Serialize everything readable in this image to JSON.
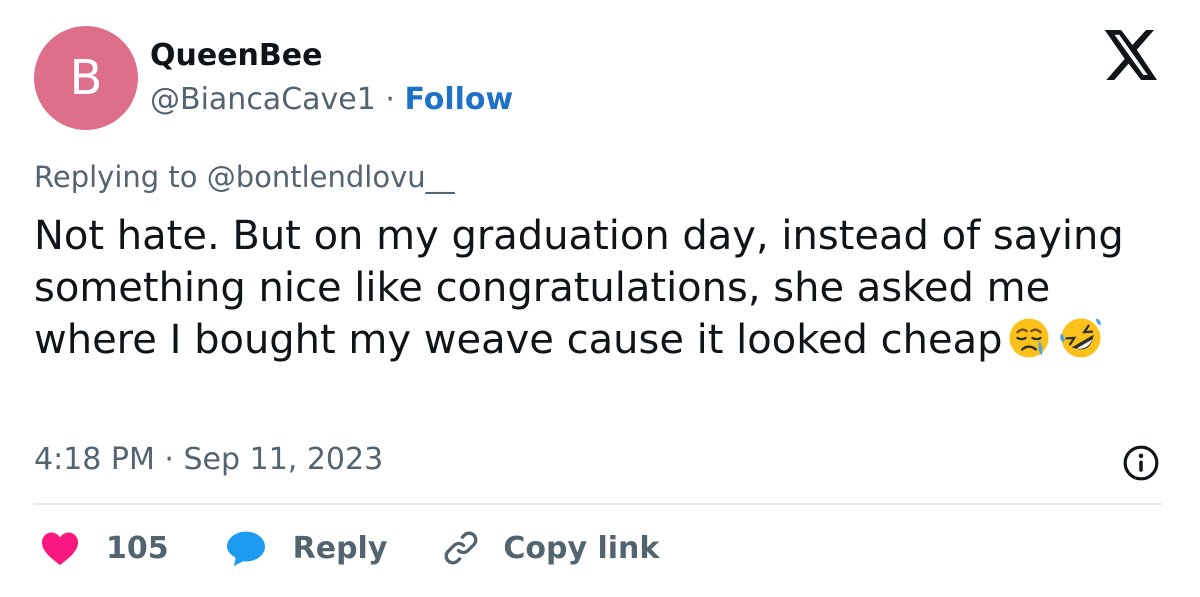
{
  "author": {
    "avatar_initial": "B",
    "avatar_color": "#dd6f8a",
    "name": "QueenBee",
    "handle": "@BiancaCave1",
    "separator": " · ",
    "follow_label": "Follow"
  },
  "platform_icon": "x-logo-icon",
  "tweet": {
    "replying_to": "Replying to @bontlendlovu__",
    "text": "Not hate. But on my graduation day, instead of saying something nice like congratulations, she asked me where I bought my weave cause it looked cheap",
    "emojis": [
      "crying-face-emoji",
      "rolling-on-floor-laughing-emoji"
    ],
    "timestamp": "4:18 PM · Sep 11, 2023"
  },
  "actions": {
    "like_count": "105",
    "reply_label": "Reply",
    "copy_link_label": "Copy link"
  },
  "colors": {
    "accent": "#1d71c8",
    "like": "#f91880",
    "reply_bubble": "#1d9bf0",
    "muted": "#536471"
  }
}
